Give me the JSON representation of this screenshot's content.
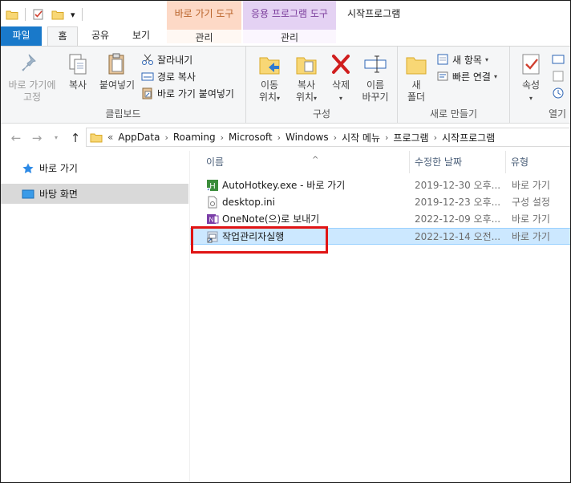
{
  "qat": {
    "dropdown_glyph": "▾"
  },
  "context_tabs": {
    "shortcut_tools": {
      "header": "바로 가기 도구",
      "sub": "관리"
    },
    "app_tools": {
      "header": "응용 프로그램 도구",
      "sub": "관리"
    }
  },
  "window_title": "시작프로그램",
  "tabs": {
    "file": "파일",
    "home": "홈",
    "share": "공유",
    "view": "보기"
  },
  "ribbon": {
    "clipboard": {
      "label": "클립보드",
      "pin": "바로 가기에\n고정",
      "copy": "복사",
      "paste": "붙여넣기",
      "cut": "잘라내기",
      "copy_path": "경로 복사",
      "paste_shortcut": "바로 가기 붙여넣기"
    },
    "organize": {
      "label": "구성",
      "move_to": "이동\n위치",
      "copy_to": "복사\n위치",
      "delete": "삭제",
      "rename": "이름\n바꾸기"
    },
    "new": {
      "label": "새로 만들기",
      "new_folder": "새\n폴더",
      "new_item": "새 항목",
      "easy_access": "빠른 연결"
    },
    "open": {
      "label": "열기",
      "properties": "속성"
    }
  },
  "address": {
    "overflow": "«",
    "crumbs": [
      "AppData",
      "Roaming",
      "Microsoft",
      "Windows",
      "시작 메뉴",
      "프로그램",
      "시작프로그램"
    ]
  },
  "nav": {
    "quick_access": "바로 가기",
    "desktop": "바탕 화면"
  },
  "columns": {
    "name": "이름",
    "modified": "수정한 날짜",
    "type": "유형"
  },
  "files": [
    {
      "name": "AutoHotkey.exe - 바로 가기",
      "modified": "2019-12-30 오후...",
      "type": "바로 가기",
      "icon": "autohotkey-icon"
    },
    {
      "name": "desktop.ini",
      "modified": "2019-12-23 오후...",
      "type": "구성 설정",
      "icon": "ini-file-icon"
    },
    {
      "name": "OneNote(으)로 보내기",
      "modified": "2022-12-09 오후...",
      "type": "바로 가기",
      "icon": "onenote-icon"
    },
    {
      "name": "작업관리자실행",
      "modified": "2022-12-14 오전...",
      "type": "바로 가기",
      "icon": "shortcut-icon"
    }
  ],
  "colors": {
    "file_tab": "#1979ca",
    "selection": "#cce8ff",
    "highlight": "#e01414"
  }
}
